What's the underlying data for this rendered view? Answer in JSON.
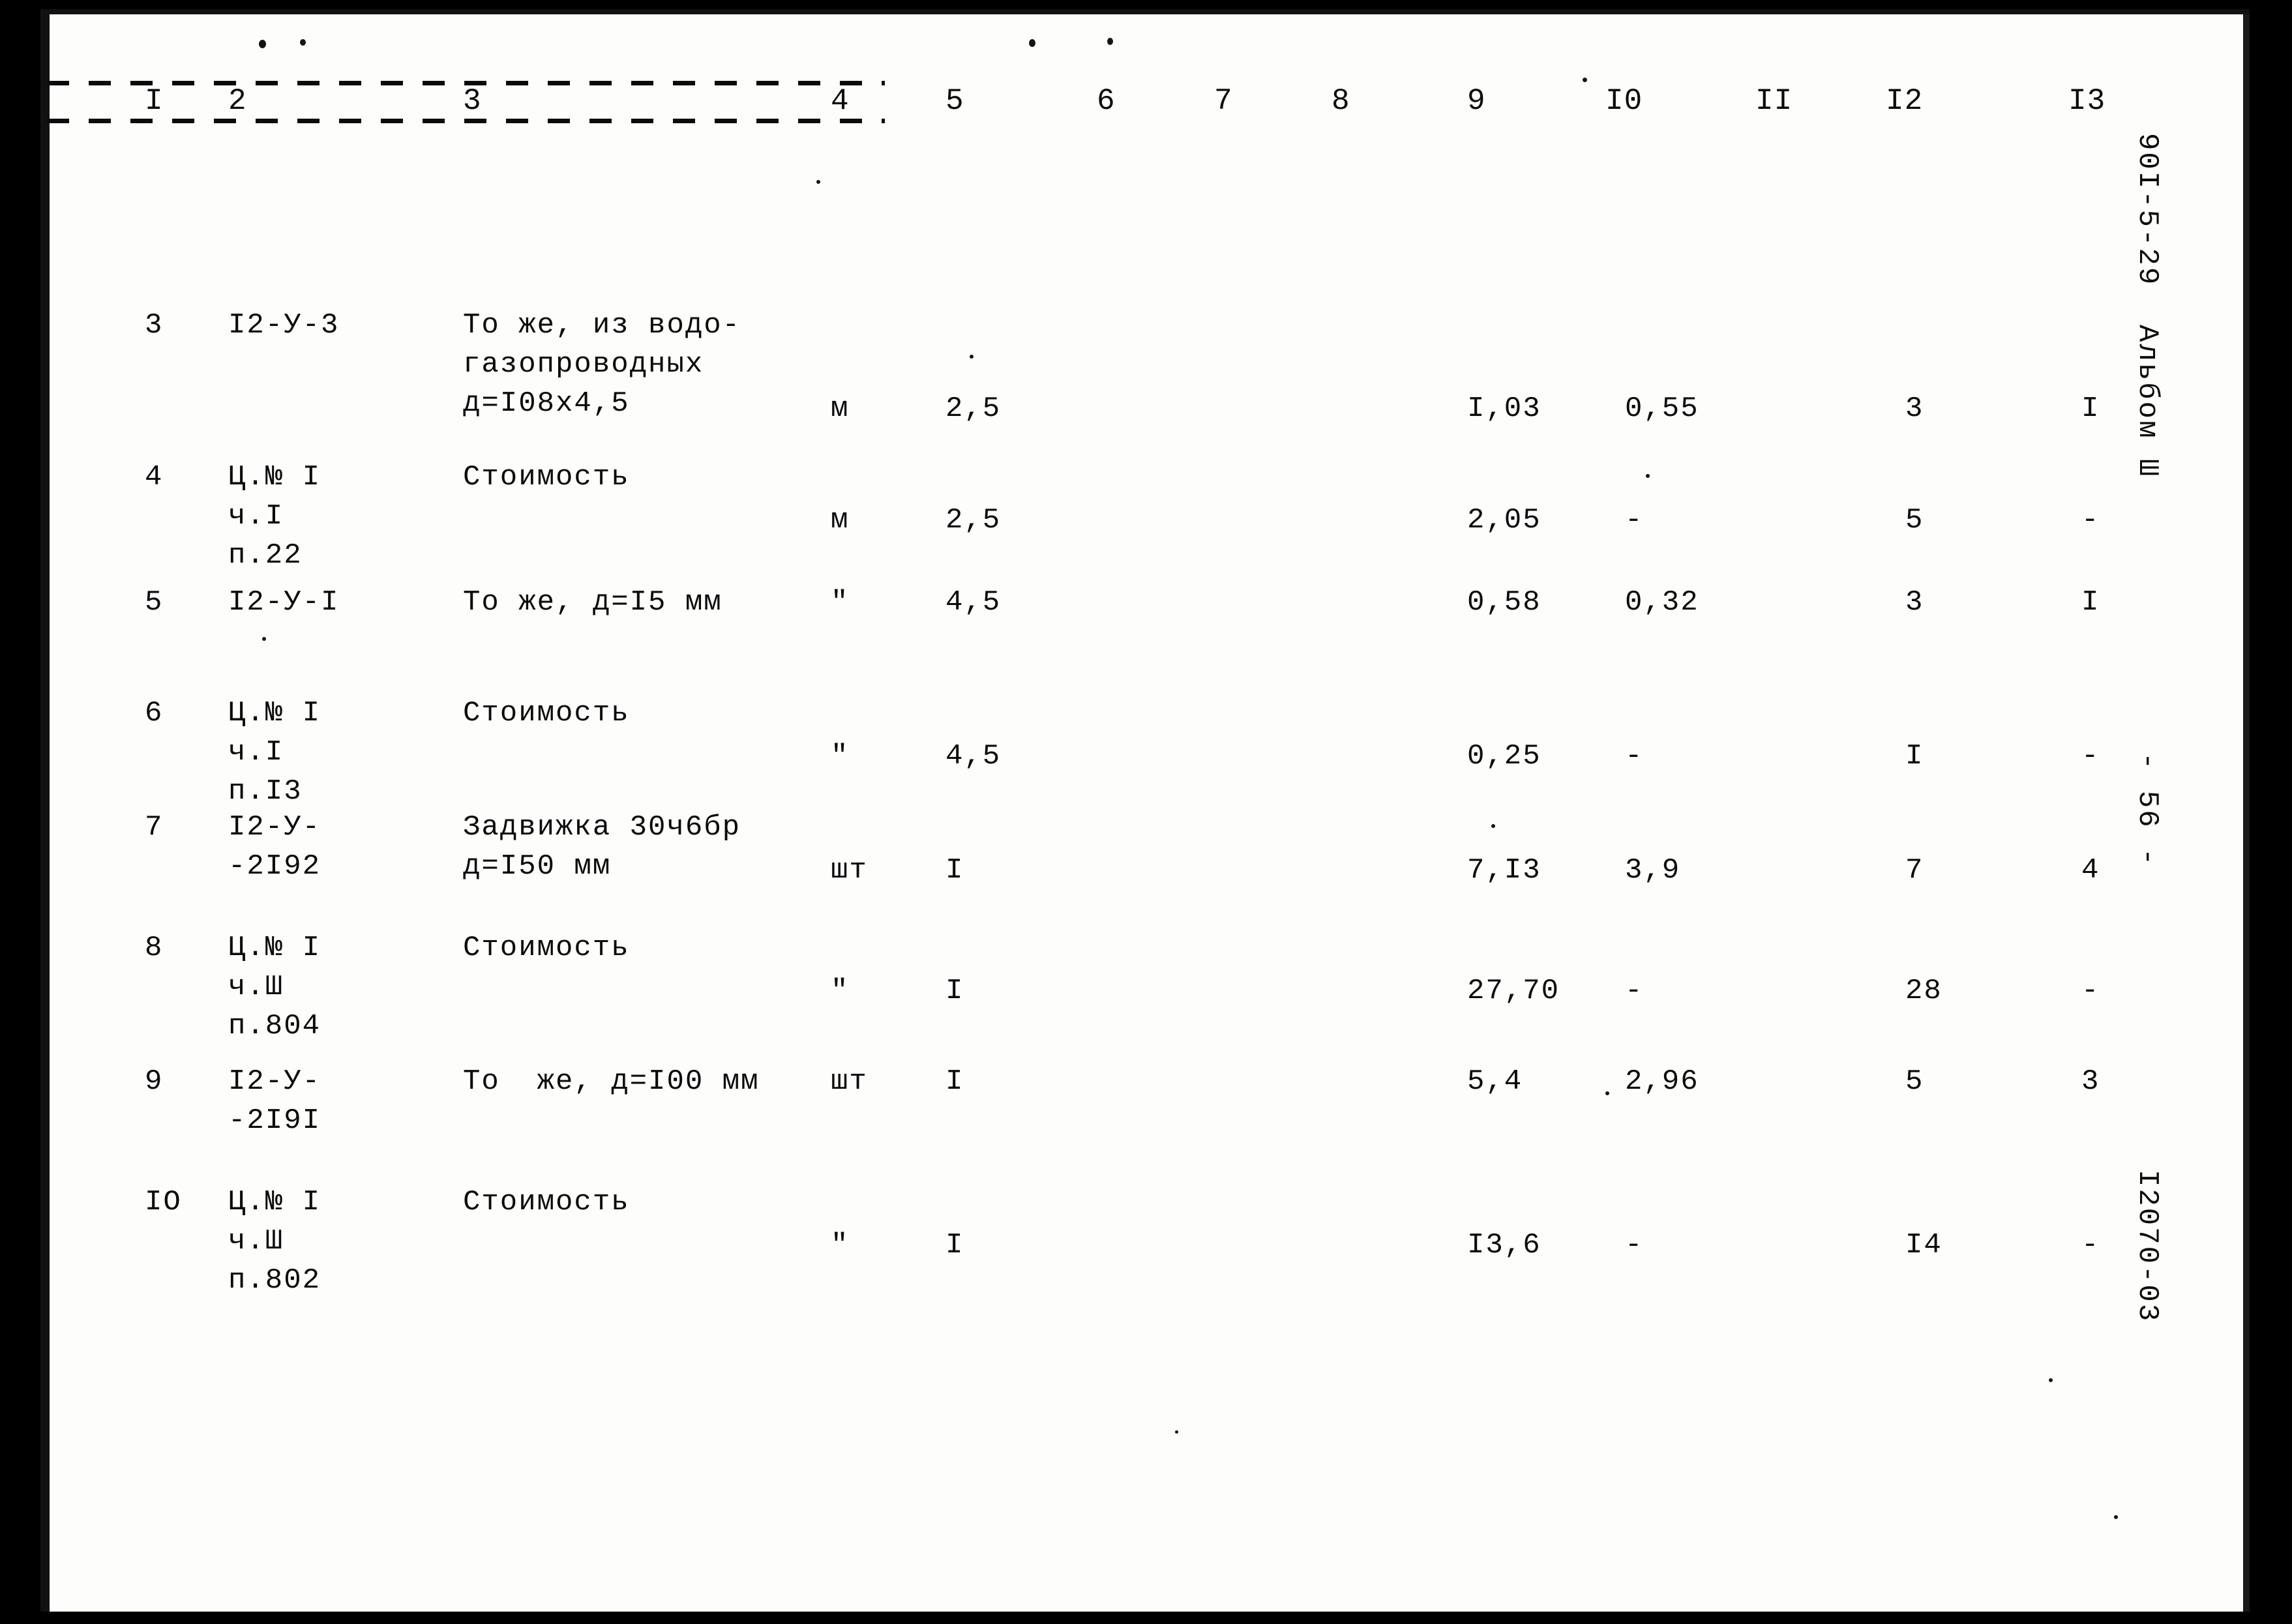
{
  "document": {
    "sheet_code": "90I-5-29  Альбом Ш",
    "page_marker": "- 56 -",
    "drawing_number": "I2070-03"
  },
  "table": {
    "column_headers": [
      "I",
      "2",
      "3",
      "4",
      "5",
      "6",
      "7",
      "8",
      "9",
      "I0",
      "II",
      "I2",
      "I3"
    ],
    "rows": [
      {
        "num": "3",
        "code": "I2-У-3",
        "desc": "То же, из водо-\nгазопроводных\nд=I08х4,5",
        "unit": "м",
        "qty": "2,5",
        "c6": "",
        "c7": "",
        "c8": "",
        "c9": "I,03",
        "c10": "0,55",
        "c11": "",
        "c12": "3",
        "c13": "I"
      },
      {
        "num": "4",
        "code": "Ц.№ I\nч.I\nп.22",
        "desc": "Стоимость",
        "unit": "м",
        "qty": "2,5",
        "c6": "",
        "c7": "",
        "c8": "",
        "c9": "2,05",
        "c10": "-",
        "c11": "",
        "c12": "5",
        "c13": "-"
      },
      {
        "num": "5",
        "code": "I2-У-I",
        "desc": "То же, д=I5 мм",
        "unit": "\"",
        "qty": "4,5",
        "c6": "",
        "c7": "",
        "c8": "",
        "c9": "0,58",
        "c10": "0,32",
        "c11": "",
        "c12": "3",
        "c13": "I"
      },
      {
        "num": "6",
        "code": "Ц.№ I\nч.I\nп.I3",
        "desc": "Стоимость",
        "unit": "\"",
        "qty": "4,5",
        "c6": "",
        "c7": "",
        "c8": "",
        "c9": "0,25",
        "c10": "-",
        "c11": "",
        "c12": "I",
        "c13": "-"
      },
      {
        "num": "7",
        "code": "I2-У-\n-2I92",
        "desc": "Задвижка 30ч6бр\nд=I50 мм",
        "unit": "шт",
        "qty": "I",
        "c6": "",
        "c7": "",
        "c8": "",
        "c9": "7,I3",
        "c10": "3,9",
        "c11": "",
        "c12": "7",
        "c13": "4"
      },
      {
        "num": "8",
        "code": "Ц.№ I\nч.Ш\nп.804",
        "desc": "Стоимость",
        "unit": "\"",
        "qty": "I",
        "c6": "",
        "c7": "",
        "c8": "",
        "c9": "27,70",
        "c10": "-",
        "c11": "",
        "c12": "28",
        "c13": "-"
      },
      {
        "num": "9",
        "code": "I2-У-\n-2I9I",
        "desc": "То  же, д=I00 мм",
        "unit": "шт",
        "qty": "I",
        "c6": "",
        "c7": "",
        "c8": "",
        "c9": "5,4",
        "c10": "2,96",
        "c11": "",
        "c12": "5",
        "c13": "3"
      },
      {
        "num": "IO",
        "code": "Ц.№ I\nч.Ш\nп.802",
        "desc": "Стоимость",
        "unit": "\"",
        "qty": "I",
        "c6": "",
        "c7": "",
        "c8": "",
        "c9": "I3,6",
        "c10": "-",
        "c11": "",
        "c12": "I4",
        "c13": "-"
      }
    ]
  }
}
